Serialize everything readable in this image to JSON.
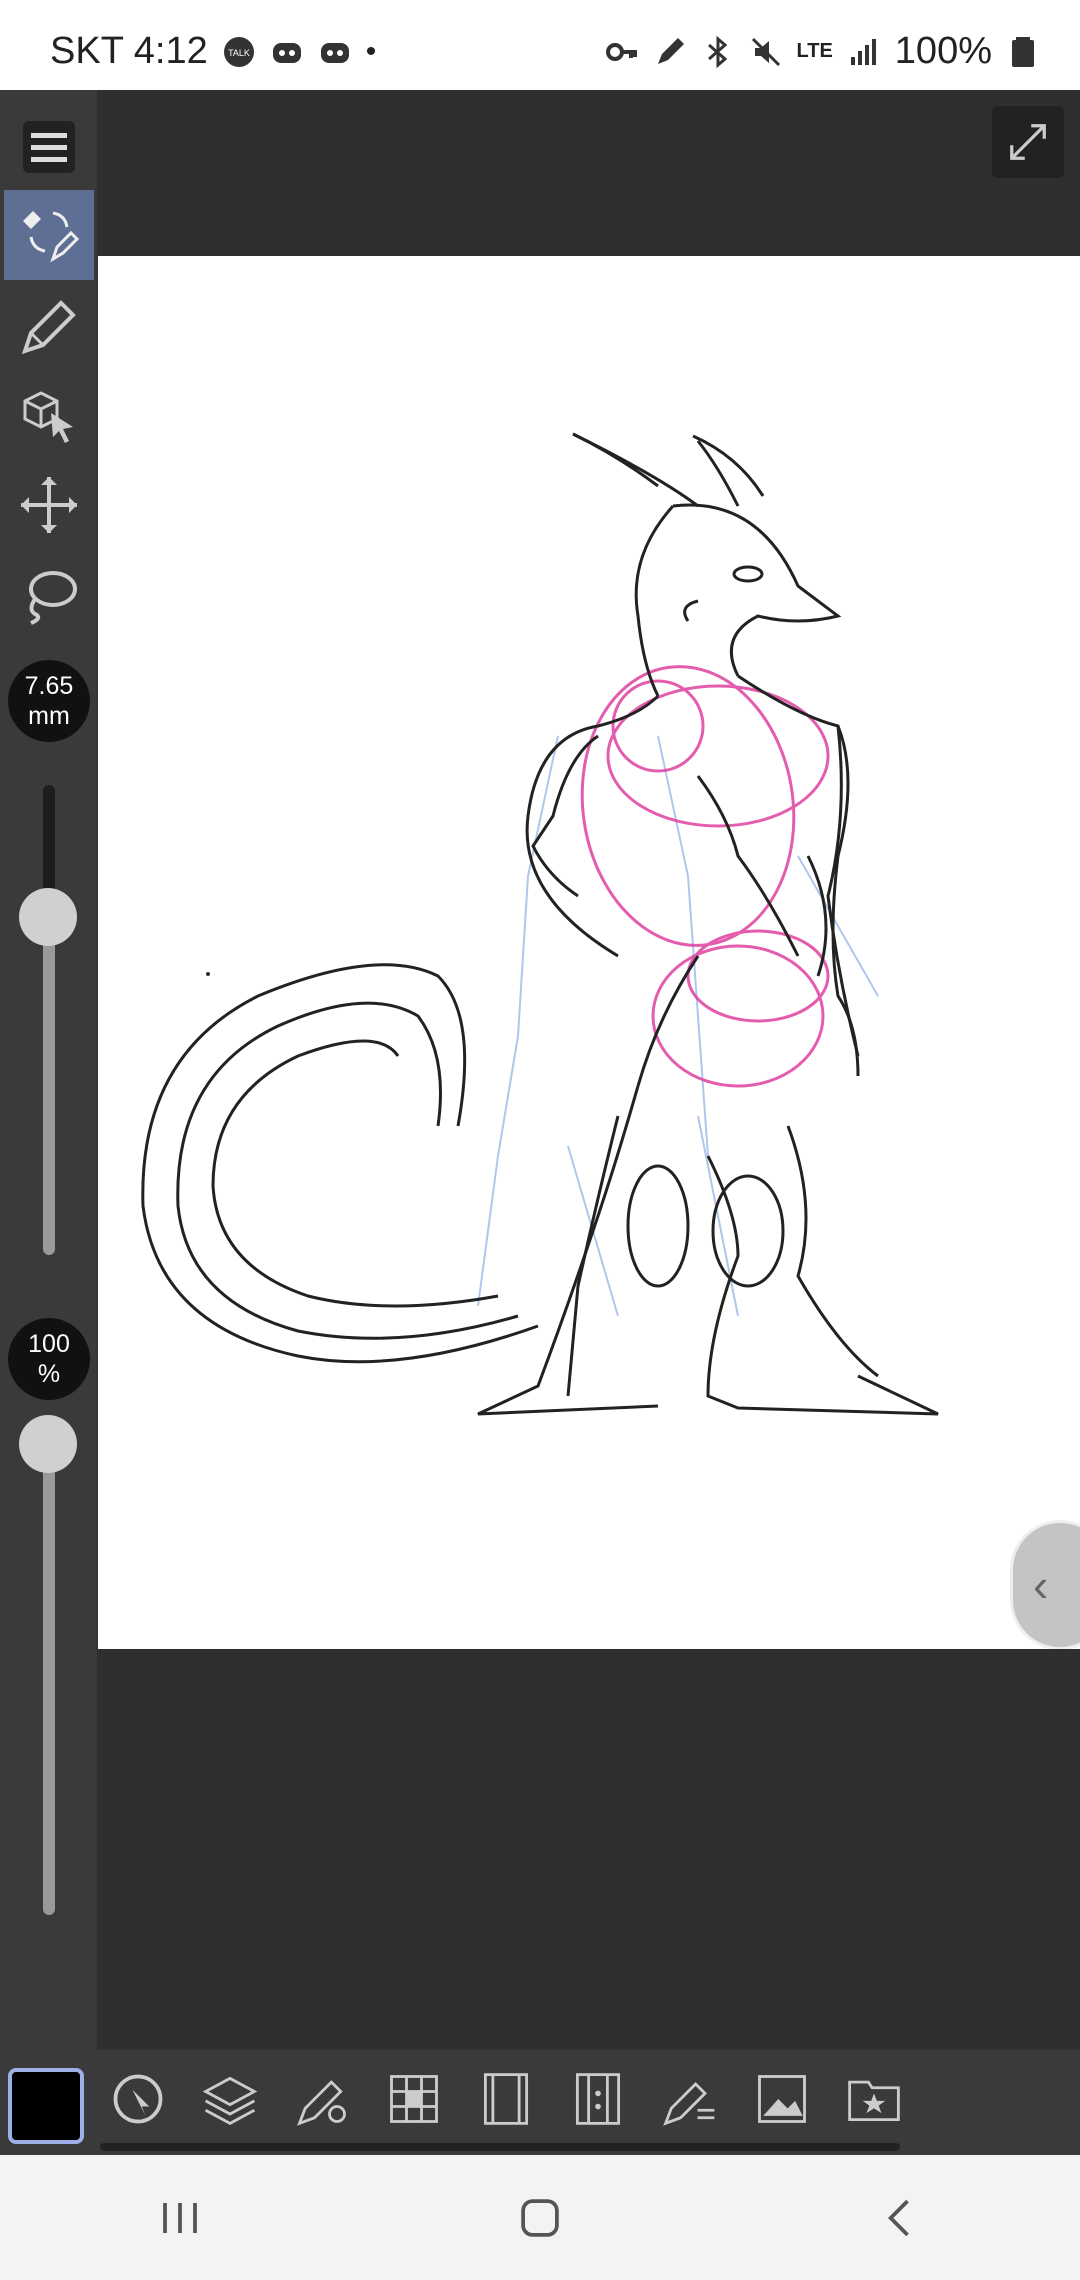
{
  "status_bar": {
    "carrier_time": "SKT 4:12",
    "network": "LTE",
    "battery": "100%"
  },
  "sidebar": {
    "brush_size": "7.65",
    "brush_size_unit": "mm",
    "opacity": "100",
    "opacity_unit": "%",
    "brush_size_slider_level": 0.28,
    "opacity_slider_level": 1.0
  },
  "colors": {
    "main": "#000000",
    "sub": "#1f2050",
    "accent": "#5f6f93"
  },
  "icons": {
    "menu": "hamburger-icon",
    "expand": "expand-icon",
    "pen": "pen-icon",
    "object": "object-select-icon",
    "move": "move-icon",
    "lasso": "lasso-icon"
  }
}
